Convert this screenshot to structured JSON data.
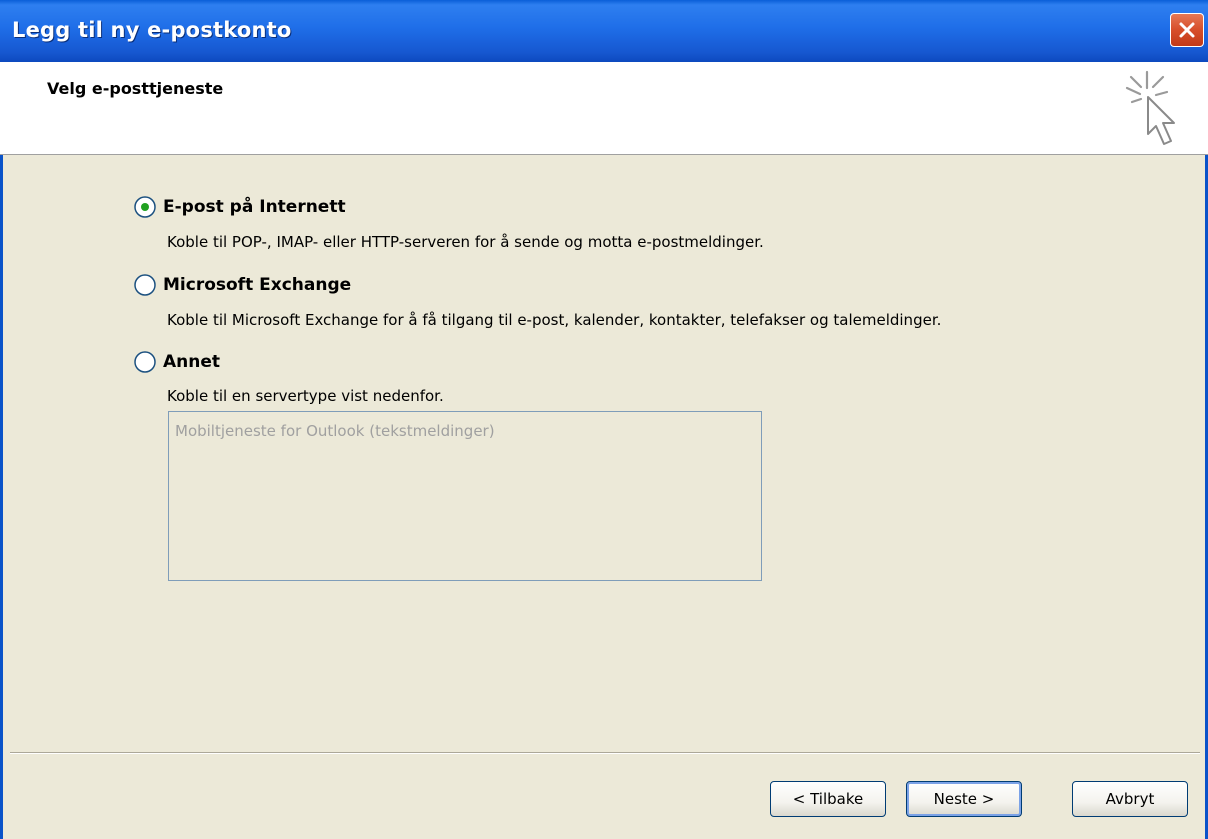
{
  "window": {
    "title": "Legg til ny e-postkonto",
    "close_icon": "close-icon"
  },
  "header": {
    "title": "Velg e-posttjeneste",
    "icon": "cursor-click-icon"
  },
  "options": [
    {
      "label": "E-post på Internett",
      "description": "Koble til POP-, IMAP- eller HTTP-serveren for å sende og motta e-postmeldinger.",
      "selected": true
    },
    {
      "label": "Microsoft Exchange",
      "description": "Koble til Microsoft Exchange for å få tilgang til e-post, kalender, kontakter, telefakser og talemeldinger.",
      "selected": false
    },
    {
      "label": "Annet",
      "description": "Koble til en servertype vist nedenfor.",
      "selected": false
    }
  ],
  "server_types": {
    "items": [
      "Mobiltjeneste for Outlook (tekstmeldinger)"
    ]
  },
  "buttons": {
    "back": "< Tilbake",
    "next": "Neste >",
    "cancel": "Avbryt"
  },
  "colors": {
    "titlebar": "#1F6EE8",
    "dialog_bg": "#ECE9D8",
    "radio_selected_dot": "#21A121"
  }
}
